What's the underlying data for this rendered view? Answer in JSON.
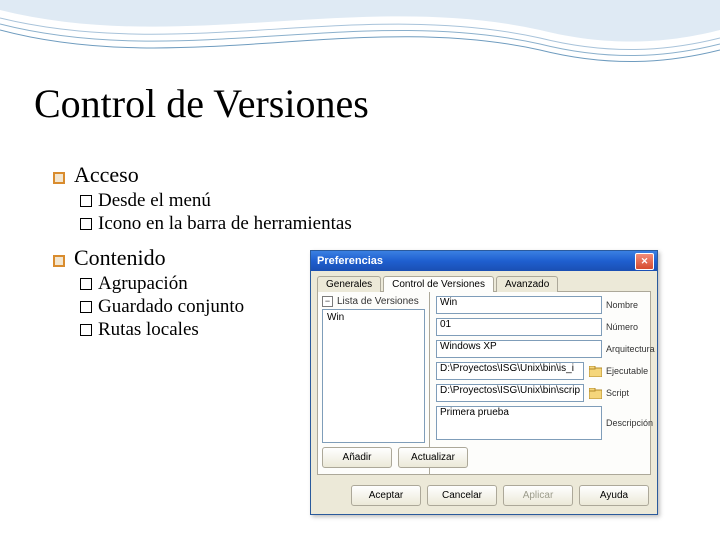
{
  "slide": {
    "title": "Control de Versiones",
    "section1": {
      "heading": "Acceso",
      "items": [
        "Desde el menú",
        "Icono en la barra de herramientas"
      ]
    },
    "section2": {
      "heading": "Contenido",
      "items": [
        "Agrupación",
        "Guardado conjunto",
        "Rutas locales"
      ]
    }
  },
  "dialog": {
    "title": "Preferencias",
    "tabs": [
      "Generales",
      "Control de Versiones",
      "Avanzado"
    ],
    "activeTab": 1,
    "list": {
      "heading": "Lista de Versiones",
      "selected": "Win"
    },
    "listButtons": {
      "add": "Añadir",
      "update": "Actualizar"
    },
    "fields": {
      "name": {
        "value": "Win",
        "label": "Nombre"
      },
      "number": {
        "value": "01",
        "label": "Número"
      },
      "arch": {
        "value": "Windows XP",
        "label": "Arquitectura"
      },
      "exec": {
        "value": "D:\\Proyectos\\ISG\\Unix\\bin\\is_i",
        "label": "Ejecutable"
      },
      "script": {
        "value": "D:\\Proyectos\\ISG\\Unix\\bin\\scrip",
        "label": "Script"
      },
      "desc": {
        "value": "Primera prueba",
        "label": "Descripción"
      }
    },
    "footer": {
      "accept": "Aceptar",
      "cancel": "Cancelar",
      "apply": "Aplicar",
      "help": "Ayuda"
    }
  },
  "icons": {
    "close_glyph": "✕",
    "minus_glyph": "−"
  }
}
